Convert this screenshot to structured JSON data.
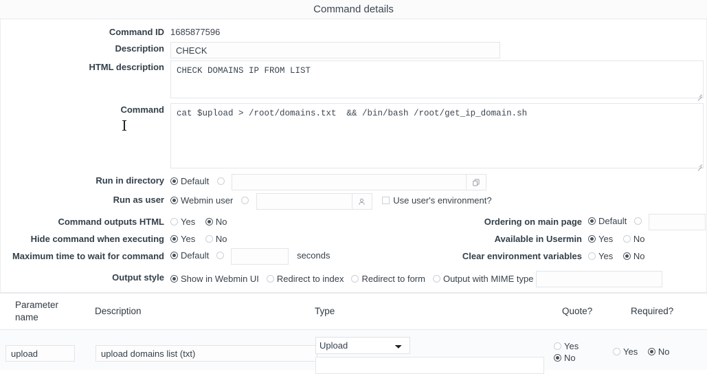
{
  "header": {
    "title": "Command details"
  },
  "fields": {
    "command_id": {
      "label": "Command ID",
      "value": "1685877596"
    },
    "description": {
      "label": "Description",
      "value": "CHECK"
    },
    "html_description": {
      "label": "HTML description",
      "value": "CHECK DOMAINS IP FROM LIST"
    },
    "command": {
      "label": "Command",
      "value": "cat $upload > /root/domains.txt  && /bin/bash /root/get_ip_domain.sh"
    },
    "run_in_directory": {
      "label": "Run in directory",
      "default_label": "Default",
      "selected": "default",
      "path_value": "",
      "chooser_icon": "file-chooser-icon"
    },
    "run_as_user": {
      "label": "Run as user",
      "webmin_user_label": "Webmin user",
      "selected": "webmin_user",
      "user_value": "",
      "chooser_icon": "user-chooser-icon",
      "use_env_label": "Use user's environment?",
      "use_env_checked": false
    },
    "command_outputs_html": {
      "label": "Command outputs HTML",
      "yes_label": "Yes",
      "no_label": "No",
      "selected": "no"
    },
    "hide_command_when_executing": {
      "label": "Hide command when executing",
      "yes_label": "Yes",
      "no_label": "No",
      "selected": "yes"
    },
    "maximum_time": {
      "label": "Maximum time to wait for command",
      "default_label": "Default",
      "selected": "default",
      "value": "",
      "unit_label": "seconds"
    },
    "ordering_on_main_page": {
      "label": "Ordering on main page",
      "default_label": "Default",
      "selected": "default",
      "value": ""
    },
    "available_in_usermin": {
      "label": "Available in Usermin",
      "yes_label": "Yes",
      "no_label": "No",
      "selected": "yes"
    },
    "clear_environment_variables": {
      "label": "Clear environment variables",
      "yes_label": "Yes",
      "no_label": "No",
      "selected": "no"
    },
    "output_style": {
      "label": "Output style",
      "selected": "show_in_webmin_ui",
      "options": [
        {
          "key": "show_in_webmin_ui",
          "label": "Show in Webmin UI"
        },
        {
          "key": "redirect_to_index",
          "label": "Redirect to index"
        },
        {
          "key": "redirect_to_form",
          "label": "Redirect to form"
        },
        {
          "key": "output_with_mime_type",
          "label": "Output with MIME type"
        }
      ],
      "mime_value": ""
    }
  },
  "params_table": {
    "columns": [
      {
        "key": "pname",
        "label": "Parameter name"
      },
      {
        "key": "desc",
        "label": "Description"
      },
      {
        "key": "type",
        "label": "Type"
      },
      {
        "key": "quote",
        "label": "Quote?"
      },
      {
        "key": "required",
        "label": "Required?"
      }
    ],
    "rows": [
      {
        "pname": "upload",
        "desc": "upload domains list (txt)",
        "type_selected": "Upload",
        "type_options": [
          "Upload"
        ],
        "type_extra_value": "",
        "quote": {
          "yes_label": "Yes",
          "no_label": "No",
          "selected": "no"
        },
        "required": {
          "yes_label": "Yes",
          "no_label": "No",
          "selected": "no"
        }
      }
    ]
  }
}
